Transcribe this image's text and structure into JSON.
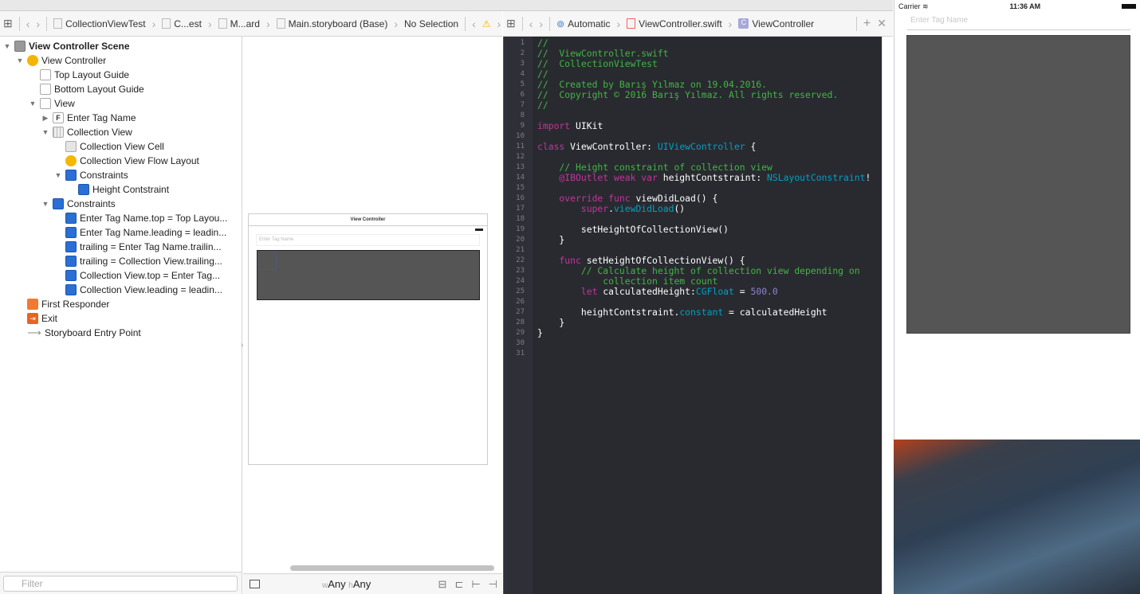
{
  "left_jumpbar": {
    "crumbs": [
      "CollectionViewTest",
      "C...est",
      "M...ard",
      "Main.storyboard (Base)",
      "No Selection"
    ]
  },
  "right_jumpbar": {
    "crumbs": [
      "Automatic",
      "ViewController.swift",
      "ViewController"
    ]
  },
  "outline": [
    {
      "label": "View Controller Scene",
      "level": 0,
      "icon": "scene",
      "open": true,
      "bold": true
    },
    {
      "label": "View Controller",
      "level": 1,
      "icon": "vc",
      "open": true
    },
    {
      "label": "Top Layout Guide",
      "level": 2,
      "icon": "guide"
    },
    {
      "label": "Bottom Layout Guide",
      "level": 2,
      "icon": "guide"
    },
    {
      "label": "View",
      "level": 2,
      "icon": "view",
      "open": true
    },
    {
      "label": "Enter Tag Name",
      "level": 3,
      "icon": "tf",
      "open": false
    },
    {
      "label": "Collection View",
      "level": 3,
      "icon": "grid",
      "open": true
    },
    {
      "label": "Collection View Cell",
      "level": 4,
      "icon": "cell"
    },
    {
      "label": "Collection View Flow Layout",
      "level": 4,
      "icon": "flow"
    },
    {
      "label": "Constraints",
      "level": 4,
      "icon": "cons",
      "open": true
    },
    {
      "label": "Height Contstraint",
      "level": 5,
      "icon": "cons"
    },
    {
      "label": "Constraints",
      "level": 3,
      "icon": "cons",
      "open": true
    },
    {
      "label": "Enter Tag Name.top = Top Layou...",
      "level": 4,
      "icon": "cons"
    },
    {
      "label": "Enter Tag Name.leading = leadin...",
      "level": 4,
      "icon": "cons"
    },
    {
      "label": "trailing = Enter Tag Name.trailin...",
      "level": 4,
      "icon": "cons"
    },
    {
      "label": "trailing = Collection View.trailing...",
      "level": 4,
      "icon": "cons"
    },
    {
      "label": "Collection View.top = Enter Tag...",
      "level": 4,
      "icon": "cons"
    },
    {
      "label": "Collection View.leading = leadin...",
      "level": 4,
      "icon": "cons"
    },
    {
      "label": "First Responder",
      "level": 1,
      "icon": "fr"
    },
    {
      "label": "Exit",
      "level": 1,
      "icon": "exit"
    },
    {
      "label": "Storyboard Entry Point",
      "level": 1,
      "icon": "entry"
    }
  ],
  "filter": {
    "placeholder": "Filter"
  },
  "canvas": {
    "scene_title": "View Controller",
    "textfield_placeholder": "Enter Tag Name",
    "size_class": {
      "w": "w",
      "w_val": "Any",
      "h": "h",
      "h_val": "Any"
    }
  },
  "code": [
    [
      [
        "//",
        "c"
      ]
    ],
    [
      [
        "//  ViewController.swift",
        "c"
      ]
    ],
    [
      [
        "//  CollectionViewTest",
        "c"
      ]
    ],
    [
      [
        "//",
        "c"
      ]
    ],
    [
      [
        "//  Created by Barış Yılmaz on 19.04.2016.",
        "c"
      ]
    ],
    [
      [
        "//  Copyright © 2016 Barış Yılmaz. All rights reserved.",
        "c"
      ]
    ],
    [
      [
        "//",
        "c"
      ]
    ],
    [],
    [
      [
        "import",
        "k"
      ],
      [
        " UIKit",
        "p"
      ]
    ],
    [],
    [
      [
        "class",
        "k"
      ],
      [
        " ViewController: ",
        "p"
      ],
      [
        "UIViewController",
        "t"
      ],
      [
        " {",
        "p"
      ]
    ],
    [],
    [
      [
        "    // Height constraint of collection view",
        "c"
      ]
    ],
    [
      [
        "    @IBOutlet weak var",
        "k"
      ],
      [
        " heightContstraint: ",
        "p"
      ],
      [
        "NSLayoutConstraint",
        "t"
      ],
      [
        "!",
        "p"
      ]
    ],
    [],
    [
      [
        "    override func",
        "k"
      ],
      [
        " viewDidLoad() {",
        "p"
      ]
    ],
    [
      [
        "        super",
        "k"
      ],
      [
        ".",
        "p"
      ],
      [
        "viewDidLoad",
        "t"
      ],
      [
        "()",
        "p"
      ]
    ],
    [],
    [
      [
        "        setHeightOfCollectionView()",
        "p"
      ]
    ],
    [
      [
        "    }",
        "p"
      ]
    ],
    [],
    [
      [
        "    func",
        "k"
      ],
      [
        " setHeightOfCollectionView() {",
        "p"
      ]
    ],
    [
      [
        "        // Calculate height of collection view depending on",
        "c"
      ]
    ],
    [
      [
        "            collection item count",
        "c"
      ]
    ],
    [
      [
        "        let",
        "k"
      ],
      [
        " calculatedHeight:",
        "p"
      ],
      [
        "CGFloat",
        "t"
      ],
      [
        " = ",
        "p"
      ],
      [
        "500.0",
        "n"
      ]
    ],
    [],
    [
      [
        "        heightContstraint.",
        "p"
      ],
      [
        "constant",
        "t"
      ],
      [
        " = calculatedHeight",
        "p"
      ]
    ],
    [
      [
        "    }",
        "p"
      ]
    ],
    [
      [
        "}",
        "p"
      ]
    ],
    [],
    []
  ],
  "simulator": {
    "carrier": "Carrier",
    "time": "11:36 AM",
    "textfield_placeholder": "Enter Tag Name"
  }
}
